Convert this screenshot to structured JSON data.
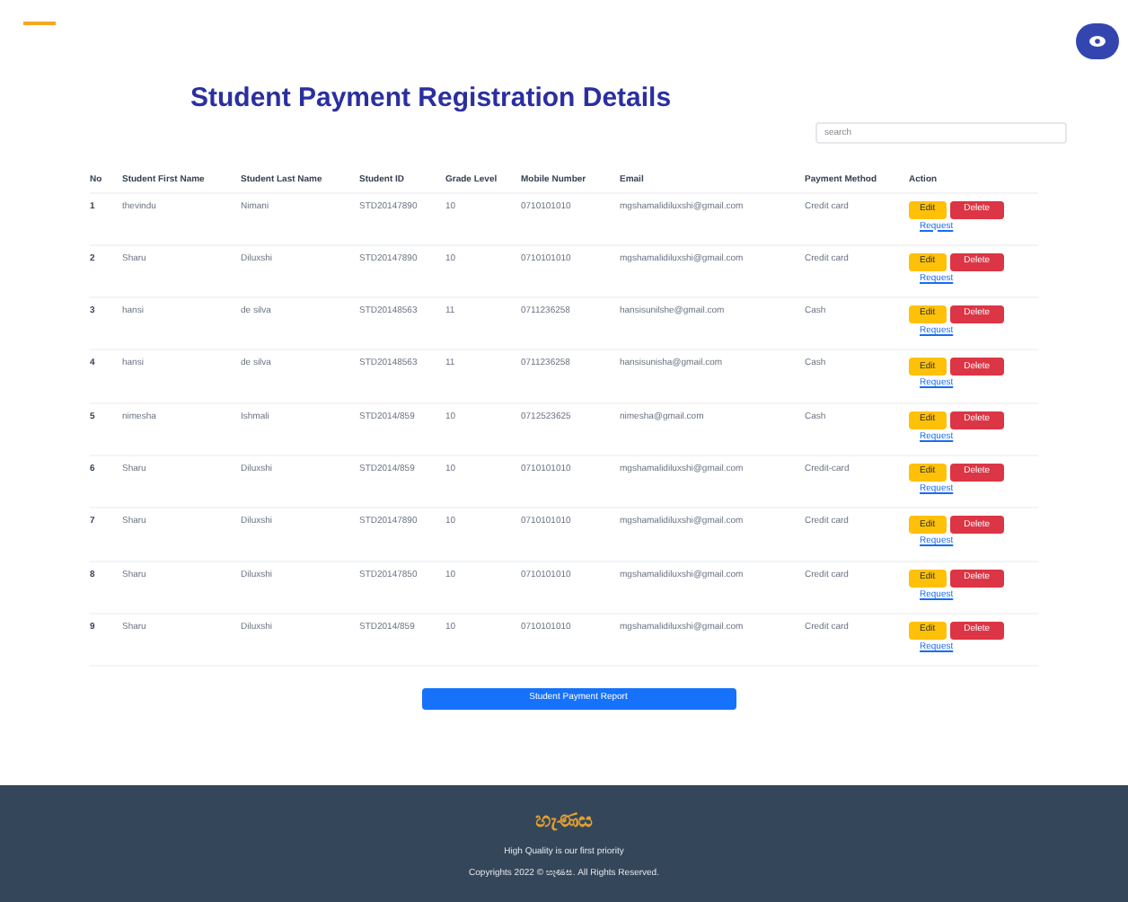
{
  "title": "Student Payment Registration Details",
  "search": {
    "placeholder": "search"
  },
  "columns": [
    "No",
    "Student First Name",
    "Student Last Name",
    "Student ID",
    "Grade Level",
    "Mobile Number",
    "Email",
    "Payment Method",
    "Action"
  ],
  "rows": [
    {
      "no": "1",
      "first": "thevindu",
      "last": "Nimani",
      "id": "STD20147890",
      "grade": "10",
      "mobile": "0710101010",
      "email": "mgshamalidiluxshi@gmail.com",
      "method": "Credit card",
      "edit": "Edit",
      "delete": "Delete",
      "link": "Request"
    },
    {
      "no": "2",
      "first": "Sharu",
      "last": "Diluxshi",
      "id": "STD20147890",
      "grade": "10",
      "mobile": "0710101010",
      "email": "mgshamalidiluxshi@gmail.com",
      "method": "Credit card",
      "edit": "Edit",
      "delete": "Delete",
      "link": "Request"
    },
    {
      "no": "3",
      "first": "hansi",
      "last": "de silva",
      "id": "STD20148563",
      "grade": "11",
      "mobile": "0711236258",
      "email": "hansisunilshe@gmail.com",
      "method": "Cash",
      "edit": "Edit",
      "delete": "Delete",
      "link": "Request"
    },
    {
      "no": "4",
      "first": "hansi",
      "last": "de silva",
      "id": "STD20148563",
      "grade": "11",
      "mobile": "0711236258",
      "email": "hansisunisha@gmail.com",
      "method": "Cash",
      "edit": "Edit",
      "delete": "Delete",
      "link": "Request"
    },
    {
      "no": "5",
      "first": "nimesha",
      "last": "Ishmali",
      "id": "STD2014/859",
      "grade": "10",
      "mobile": "0712523625",
      "email": "nimesha@gmail.com",
      "method": "Cash",
      "edit": "Edit",
      "delete": "Delete",
      "link": "Request"
    },
    {
      "no": "6",
      "first": "Sharu",
      "last": "Diluxshi",
      "id": "STD2014/859",
      "grade": "10",
      "mobile": "0710101010",
      "email": "mgshamalidiluxshi@gmail.com",
      "method": "Credit-card",
      "edit": "Edit",
      "delete": "Delete",
      "link": "Request"
    },
    {
      "no": "7",
      "first": "Sharu",
      "last": "Diluxshi",
      "id": "STD20147890",
      "grade": "10",
      "mobile": "0710101010",
      "email": "mgshamalidiluxshi@gmail.com",
      "method": "Credit card",
      "edit": "Edit",
      "delete": "Delete",
      "link": "Request"
    },
    {
      "no": "8",
      "first": "Sharu",
      "last": "Diluxshi",
      "id": "STD20147850",
      "grade": "10",
      "mobile": "0710101010",
      "email": "mgshamalidiluxshi@gmail.com",
      "method": "Credit card",
      "edit": "Edit",
      "delete": "Delete",
      "link": "Request"
    },
    {
      "no": "9",
      "first": "Sharu",
      "last": "Diluxshi",
      "id": "STD2014/859",
      "grade": "10",
      "mobile": "0710101010",
      "email": "mgshamalidiluxshi@gmail.com",
      "method": "Credit card",
      "edit": "Edit",
      "delete": "Delete",
      "link": "Request"
    }
  ],
  "report_button": "Student Payment Report",
  "footer": {
    "logo": "හැණස",
    "tagline": "High Quality is our first priority",
    "copyright": "Copyrights 2022 © හැණස. All Rights Reserved."
  }
}
